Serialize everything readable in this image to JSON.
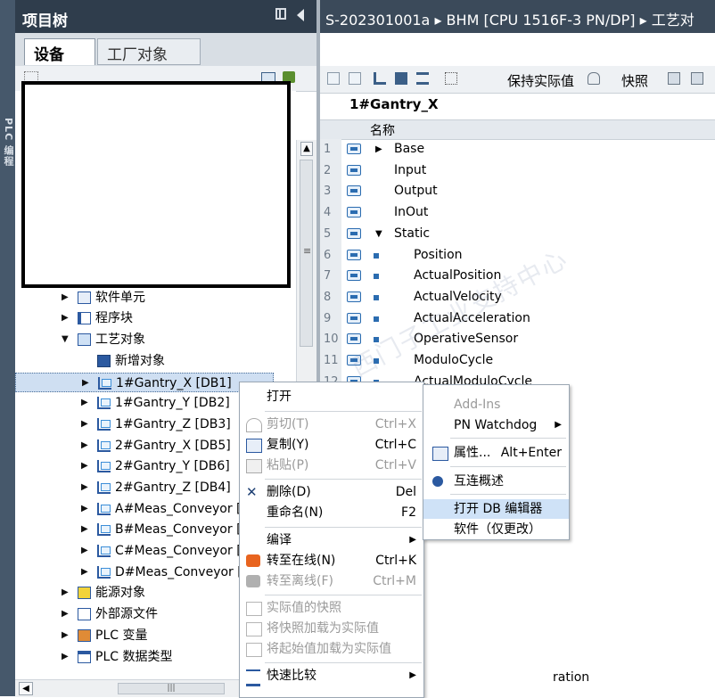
{
  "left_strip": {
    "label": "PLC 编程"
  },
  "tree": {
    "title": "项目树",
    "tabs": [
      "设备",
      "工厂对象"
    ],
    "items": [
      {
        "label": "软件单元",
        "icon": "software-unit-icon",
        "expand": "▶"
      },
      {
        "label": "程序块",
        "icon": "program-blocks-icon",
        "expand": "▶"
      },
      {
        "label": "工艺对象",
        "icon": "technology-objects-icon",
        "expand": "▼"
      },
      {
        "label": "新增对象",
        "icon": "add-object-icon",
        "expand": ""
      },
      {
        "label": "1#Gantry_X [DB1]",
        "icon": "axis-icon",
        "expand": "▶"
      },
      {
        "label": "1#Gantry_Y [DB2]",
        "icon": "axis-icon",
        "expand": "▶"
      },
      {
        "label": "1#Gantry_Z [DB3]",
        "icon": "axis-icon",
        "expand": "▶"
      },
      {
        "label": "2#Gantry_X [DB5]",
        "icon": "axis-icon",
        "expand": "▶"
      },
      {
        "label": "2#Gantry_Y [DB6]",
        "icon": "axis-icon",
        "expand": "▶"
      },
      {
        "label": "2#Gantry_Z [DB4]",
        "icon": "axis-icon",
        "expand": "▶"
      },
      {
        "label": "A#Meas_Conveyor [",
        "icon": "axis-icon",
        "expand": "▶"
      },
      {
        "label": "B#Meas_Conveyor [",
        "icon": "axis-icon",
        "expand": "▶"
      },
      {
        "label": "C#Meas_Conveyor [",
        "icon": "axis-icon",
        "expand": "▶"
      },
      {
        "label": "D#Meas_Conveyor [",
        "icon": "axis-icon",
        "expand": "▶"
      },
      {
        "label": "能源对象",
        "icon": "energy-objects-icon",
        "expand": "▶"
      },
      {
        "label": "外部源文件",
        "icon": "external-source-icon",
        "expand": "▶"
      },
      {
        "label": "PLC 变量",
        "icon": "plc-tags-icon",
        "expand": "▶"
      },
      {
        "label": "PLC 数据类型",
        "icon": "plc-data-types-icon",
        "expand": "▶"
      }
    ]
  },
  "editor": {
    "breadcrumb": "S-202301001a ▸ BHM [CPU 1516F-3 PN/DP] ▸ 工艺对",
    "toolbar": {
      "keep_actual": "保持实际值",
      "snapshot": "快照"
    },
    "db_title": "1#Gantry_X",
    "column_name": "名称",
    "rows": [
      {
        "num": "1",
        "name": "Base",
        "marker": "▶",
        "indent": 0
      },
      {
        "num": "2",
        "name": "Input",
        "marker": "",
        "indent": 0
      },
      {
        "num": "3",
        "name": "Output",
        "marker": "",
        "indent": 0
      },
      {
        "num": "4",
        "name": "InOut",
        "marker": "",
        "indent": 0
      },
      {
        "num": "5",
        "name": "Static",
        "marker": "▼",
        "indent": 0
      },
      {
        "num": "6",
        "name": "Position",
        "marker": "■",
        "indent": 1
      },
      {
        "num": "7",
        "name": "ActualPosition",
        "marker": "■",
        "indent": 1
      },
      {
        "num": "8",
        "name": "ActualVelocity",
        "marker": "■",
        "indent": 1
      },
      {
        "num": "9",
        "name": "ActualAcceleration",
        "marker": "■",
        "indent": 1
      },
      {
        "num": "10",
        "name": "OperativeSensor",
        "marker": "■",
        "indent": 1
      },
      {
        "num": "11",
        "name": "ModuloCycle",
        "marker": "■",
        "indent": 1
      },
      {
        "num": "12",
        "name": "ActualModuloCycle",
        "marker": "■",
        "indent": 1
      }
    ],
    "bottom_text": "ration",
    "watermark": "西门子工业支持中心"
  },
  "context_menu": {
    "items": [
      {
        "label": "打开",
        "shortcut": "",
        "disabled": false,
        "icon": ""
      },
      {
        "label": "剪切(T)",
        "shortcut": "Ctrl+X",
        "disabled": true,
        "icon": "scissors-icon"
      },
      {
        "label": "复制(Y)",
        "shortcut": "Ctrl+C",
        "disabled": false,
        "icon": "copy-icon"
      },
      {
        "label": "粘贴(P)",
        "shortcut": "Ctrl+V",
        "disabled": true,
        "icon": "paste-icon"
      },
      {
        "label": "删除(D)",
        "shortcut": "Del",
        "disabled": false,
        "icon": "delete-icon"
      },
      {
        "label": "重命名(N)",
        "shortcut": "F2",
        "disabled": false,
        "icon": ""
      },
      {
        "label": "编译",
        "shortcut": "",
        "disabled": false,
        "icon": "",
        "submenu": true
      },
      {
        "label": "转至在线(N)",
        "shortcut": "Ctrl+K",
        "disabled": false,
        "icon": "go-online-icon"
      },
      {
        "label": "转至离线(F)",
        "shortcut": "Ctrl+M",
        "disabled": true,
        "icon": "go-offline-icon"
      },
      {
        "label": "实际值的快照",
        "shortcut": "",
        "disabled": true,
        "icon": "snapshot-icon"
      },
      {
        "label": "将快照加载为实际值",
        "shortcut": "",
        "disabled": true,
        "icon": "load-snapshot-icon"
      },
      {
        "label": "将起始值加载为实际值",
        "shortcut": "",
        "disabled": true,
        "icon": "load-start-values-icon"
      },
      {
        "label": "快速比较",
        "shortcut": "",
        "disabled": false,
        "icon": "compare-icon",
        "submenu": true
      }
    ]
  },
  "sub_menu": {
    "items": [
      {
        "label": "Add-Ins",
        "shortcut": "",
        "disabled": true
      },
      {
        "label": "PN Watchdog",
        "shortcut": "",
        "disabled": false,
        "submenu": true
      },
      {
        "label": "属性...",
        "shortcut": "Alt+Enter",
        "disabled": false,
        "icon": "properties-icon"
      },
      {
        "label": "互连概述",
        "shortcut": "",
        "disabled": false,
        "icon": "interconnection-icon"
      },
      {
        "label": "打开 DB 编辑器",
        "shortcut": "",
        "disabled": false,
        "highlighted": true
      },
      {
        "label": "软件（仅更改）",
        "shortcut": "",
        "disabled": false
      }
    ]
  },
  "colors": {
    "tree_header_bg": "#2f3d4c",
    "editor_header_bg": "#3b4a5a",
    "left_strip_bg": "#46586b",
    "selection_bg": "#cfdff2",
    "menu_highlight": "#cfe2f7",
    "io_icon_blue": "#2b6cb0"
  }
}
